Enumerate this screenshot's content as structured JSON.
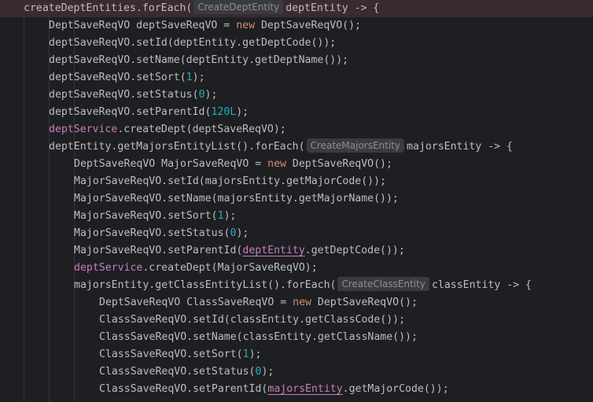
{
  "editor": {
    "lines": [
      {
        "indent": 0,
        "current": true,
        "tokens": [
          {
            "t": "createDeptEntities.forEach("
          },
          {
            "t": "CreateDeptEntity",
            "k": "hint"
          },
          {
            "t": "deptEntity -> {"
          }
        ]
      },
      {
        "indent": 1,
        "tokens": [
          {
            "t": "DeptSaveReqVO deptSaveReqVO = "
          },
          {
            "t": "new",
            "k": "kw"
          },
          {
            "t": " DeptSaveReqVO();"
          }
        ]
      },
      {
        "indent": 1,
        "tokens": [
          {
            "t": "deptSaveReqVO.setId(deptEntity.getDeptCode());"
          }
        ]
      },
      {
        "indent": 1,
        "tokens": [
          {
            "t": "deptSaveReqVO.setName(deptEntity.getDeptName());"
          }
        ]
      },
      {
        "indent": 1,
        "tokens": [
          {
            "t": "deptSaveReqVO.setSort("
          },
          {
            "t": "1",
            "k": "num"
          },
          {
            "t": ");"
          }
        ]
      },
      {
        "indent": 1,
        "tokens": [
          {
            "t": "deptSaveReqVO.setStatus("
          },
          {
            "t": "0",
            "k": "num"
          },
          {
            "t": ");"
          }
        ]
      },
      {
        "indent": 1,
        "tokens": [
          {
            "t": "deptSaveReqVO.setParentId("
          },
          {
            "t": "120L",
            "k": "num"
          },
          {
            "t": ");"
          }
        ]
      },
      {
        "indent": 1,
        "tokens": [
          {
            "t": "deptService",
            "k": "fld"
          },
          {
            "t": ".createDept(deptSaveReqVO);"
          }
        ]
      },
      {
        "indent": 1,
        "tokens": [
          {
            "t": "deptEntity.getMajorsEntityList().forEach("
          },
          {
            "t": "CreateMajorsEntity",
            "k": "hint"
          },
          {
            "t": "majorsEntity -> {"
          }
        ]
      },
      {
        "indent": 2,
        "tokens": [
          {
            "t": "DeptSaveReqVO MajorSaveReqVO = "
          },
          {
            "t": "new",
            "k": "kw"
          },
          {
            "t": " DeptSaveReqVO();"
          }
        ]
      },
      {
        "indent": 2,
        "tokens": [
          {
            "t": "MajorSaveReqVO.setId(majorsEntity.getMajorCode());"
          }
        ]
      },
      {
        "indent": 2,
        "tokens": [
          {
            "t": "MajorSaveReqVO.setName(majorsEntity.getMajorName());"
          }
        ]
      },
      {
        "indent": 2,
        "tokens": [
          {
            "t": "MajorSaveReqVO.setSort("
          },
          {
            "t": "1",
            "k": "num"
          },
          {
            "t": ");"
          }
        ]
      },
      {
        "indent": 2,
        "tokens": [
          {
            "t": "MajorSaveReqVO.setStatus("
          },
          {
            "t": "0",
            "k": "num"
          },
          {
            "t": ");"
          }
        ]
      },
      {
        "indent": 2,
        "tokens": [
          {
            "t": "MajorSaveReqVO.setParentId("
          },
          {
            "t": "deptEntity",
            "k": "fld-u"
          },
          {
            "t": ".getDeptCode());"
          }
        ]
      },
      {
        "indent": 2,
        "tokens": [
          {
            "t": "deptService",
            "k": "fld"
          },
          {
            "t": ".createDept(MajorSaveReqVO);"
          }
        ]
      },
      {
        "indent": 2,
        "tokens": [
          {
            "t": "majorsEntity.getClassEntityList().forEach("
          },
          {
            "t": "CreateClassEntity",
            "k": "hint"
          },
          {
            "t": "classEntity -> {"
          }
        ]
      },
      {
        "indent": 3,
        "tokens": [
          {
            "t": "DeptSaveReqVO ClassSaveReqVO = "
          },
          {
            "t": "new",
            "k": "kw"
          },
          {
            "t": " DeptSaveReqVO();"
          }
        ]
      },
      {
        "indent": 3,
        "tokens": [
          {
            "t": "ClassSaveReqVO.setId(classEntity.getClassCode());"
          }
        ]
      },
      {
        "indent": 3,
        "tokens": [
          {
            "t": "ClassSaveReqVO.setName(classEntity.getClassName());"
          }
        ]
      },
      {
        "indent": 3,
        "tokens": [
          {
            "t": "ClassSaveReqVO.setSort("
          },
          {
            "t": "1",
            "k": "num"
          },
          {
            "t": ");"
          }
        ]
      },
      {
        "indent": 3,
        "tokens": [
          {
            "t": "ClassSaveReqVO.setStatus("
          },
          {
            "t": "0",
            "k": "num"
          },
          {
            "t": ");"
          }
        ]
      },
      {
        "indent": 3,
        "tokens": [
          {
            "t": "ClassSaveReqVO.setParentId("
          },
          {
            "t": "majorsEntity",
            "k": "fld-u"
          },
          {
            "t": ".getMajorCode());"
          }
        ]
      }
    ]
  },
  "colors": {
    "background": "#1e1f22",
    "text": "#bcbec4",
    "keyword": "#cf8e6d",
    "number": "#2aacb8",
    "field": "#c77dbb",
    "inlay_hint_bg": "#393b40",
    "inlay_hint_text": "#8c8e94",
    "current_line": "#3b2a30"
  }
}
